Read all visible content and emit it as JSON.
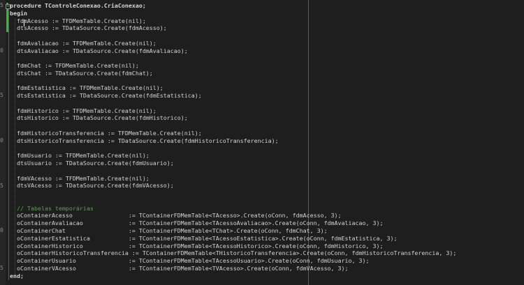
{
  "gutter_numbers": [
    "5",
    "",
    "",
    "",
    "",
    "",
    "0",
    "",
    "",
    "",
    "",
    "",
    "5",
    "",
    "",
    "",
    "",
    "",
    "0",
    "",
    "",
    "",
    "",
    "",
    "5",
    "",
    "",
    "",
    "",
    "",
    "0",
    "",
    "",
    "",
    "",
    "5",
    ""
  ],
  "code_lines": [
    "procedure TControleConexao.CriaConexao;",
    "begin",
    "  fdmAcesso := TFDMemTable.Create(nil);",
    "  dtsAcesso := TDataSource.Create(fdmAcesso);",
    "",
    "  fdmAvaliacao := TFDMemTable.Create(nil);",
    "  dtsAvaliacao := TDataSource.Create(fdmAvaliacao);",
    "",
    "  fdmChat := TFDMemTable.Create(nil);",
    "  dtsChat := TDataSource.Create(fdmChat);",
    "",
    "  fdmEstatistica := TFDMemTable.Create(nil);",
    "  dtsEstatistica := TDataSource.Create(fdmEstatistica);",
    "",
    "  fdmHistorico := TFDMemTable.Create(nil);",
    "  dtsHistorico := TDataSource.Create(fdmHistorico);",
    "",
    "  fdmHistoricoTransferencia := TFDMemTable.Create(nil);",
    "  dtsHistoricoTransferencia := TDataSource.Create(fdmHistoricoTransferencia);",
    "",
    "  fdmUsuario := TFDMemTable.Create(nil);",
    "  dtsUsuario := TDataSource.Create(fdmUsuario);",
    "",
    "  fdmVAcesso := TFDMemTable.Create(nil);",
    "  dtsVAcesso := TDataSource.Create(fdmVAcesso);",
    "",
    "",
    "  // Tabelas temporárias",
    "  oContainerAcesso                := TContainerFDMemTable<TAcesso>.Create(oConn, fdmAcesso, 3);",
    "  oContainerAvaliacao             := TContainerFDMemTable<TAcessoAvaliacao>.Create(oConn, fdmAvaliacao, 3);",
    "  oContainerChat                  := TContainerFDMemTable<TChat>.Create(oConn, fdmChat, 3);",
    "  oContainerEstatistica           := TContainerFDMemTable<TAcessoEstatistica>.Create(oConn, fdmEstatistica, 3);",
    "  oContainerHistorico             := TContainerFDMemTable<TAcessoHistorico>.Create(oConn, fdmHistorico, 3);",
    "  oContainerHistoricoTransferencia := TContainerFDMemTable<THistoricoTransferencia>.Create(oConn, fdmHistoricoTransferencia, 3);",
    "  oContainerUsuario               := TContainerFDMemTable<TAcessoUsuario>.Create(oConn, fdmUsuario, 3);",
    "  oContainerVAcesso               := TContainerFDMemTable<TVAcesso>.Create(oConn, fdmVAcesso, 3);",
    "end;"
  ],
  "colors": {
    "background": "#1e1e1e",
    "text": "#d4d4d4",
    "keyword": "#d6d6d6",
    "comment": "#57a64a",
    "modified_bar": "#28c228",
    "margin_line": "#5b5b5b"
  },
  "icons": {
    "fold": "fold-minus-icon"
  }
}
